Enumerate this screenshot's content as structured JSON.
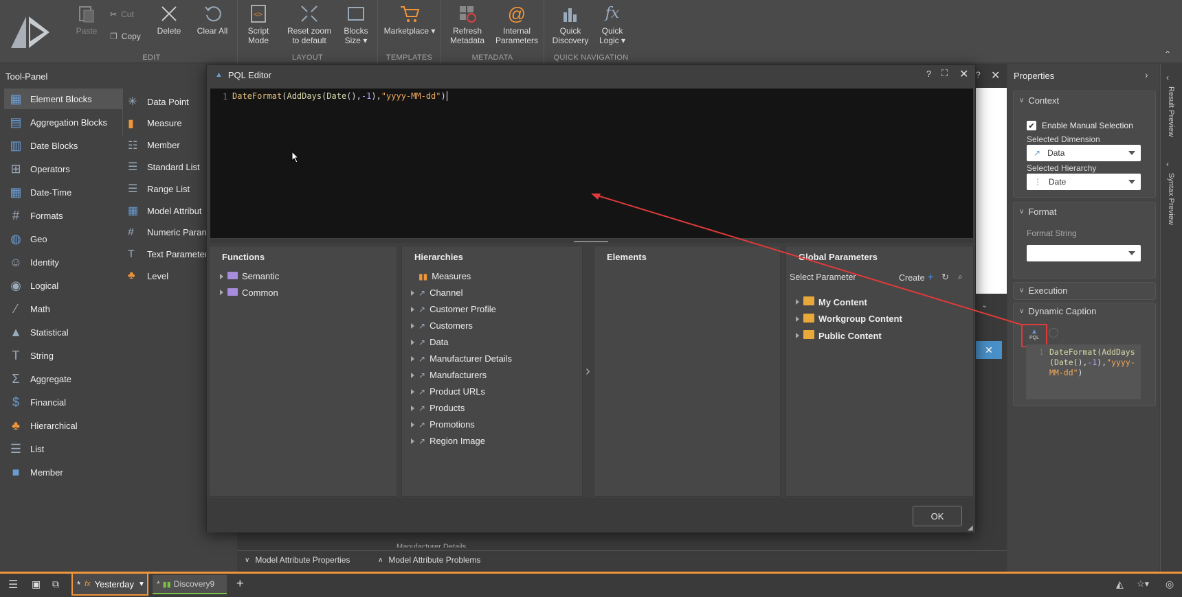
{
  "ribbon": {
    "edit": {
      "label": "EDIT",
      "paste": "Paste",
      "cut": "Cut",
      "copy": "Copy",
      "delete": "Delete",
      "clear_all": "Clear All"
    },
    "layout": {
      "label": "LAYOUT",
      "script_mode": "Script\nMode",
      "reset_zoom": "Reset zoom\nto default",
      "blocks_size": "Blocks\nSize ▾"
    },
    "templates": {
      "label": "TEMPLATES",
      "marketplace": "Marketplace ▾"
    },
    "metadata": {
      "label": "METADATA",
      "refresh": "Refresh\nMetadata",
      "internal": "Internal\nParameters"
    },
    "quick_nav": {
      "label": "QUICK NAVIGATION",
      "quick_discovery": "Quick\nDiscovery",
      "quick_logic": "Quick\nLogic ▾"
    }
  },
  "tool_panel": {
    "title": "Tool-Panel",
    "categories": [
      "Element Blocks",
      "Aggregation Blocks",
      "Date Blocks",
      "Operators",
      "Date-Time",
      "Formats",
      "Geo",
      "Identity",
      "Logical",
      "Math",
      "Statistical",
      "String",
      "Aggregate",
      "Financial",
      "Hierarchical",
      "List",
      "Member"
    ],
    "elements": [
      "Data Point",
      "Measure",
      "Member",
      "Standard List",
      "Range List",
      "Model Attribut",
      "Numeric Paran",
      "Text Parameter",
      "Level"
    ]
  },
  "modal": {
    "title": "PQL Editor",
    "line_number": "1",
    "code": {
      "p1": "DateFormat",
      "p2": "(",
      "p3": "AddDays",
      "p4": "(",
      "p5": "Date",
      "p6": "(),",
      "p7": "-1",
      "p8": "),",
      "p9": "\"yyyy-MM-dd\"",
      "p10": ")"
    },
    "functions": {
      "title": "Functions",
      "items": [
        "Semantic",
        "Common"
      ]
    },
    "hierarchies": {
      "title": "Hierarchies",
      "items": [
        "Measures",
        "Channel",
        "Customer Profile",
        "Customers",
        "Data",
        "Manufacturer Details",
        "Manufacturers",
        "Product URLs",
        "Products",
        "Promotions",
        "Region Image"
      ]
    },
    "elements": {
      "title": "Elements"
    },
    "global_params": {
      "title": "Global Parameters",
      "select": "Select Parameter",
      "create": "Create",
      "items": [
        "My Content",
        "Workgroup Content",
        "Public Content"
      ]
    },
    "ok": "OK"
  },
  "properties": {
    "title": "Properties",
    "context": {
      "title": "Context",
      "enable_manual": "Enable Manual Selection",
      "selected_dimension_label": "Selected Dimension",
      "selected_dimension": "Data",
      "selected_hierarchy_label": "Selected Hierarchy",
      "selected_hierarchy": "Date"
    },
    "format": {
      "title": "Format",
      "format_string_label": "Format String",
      "format_string": ""
    },
    "execution": {
      "title": "Execution"
    },
    "dynamic_caption": {
      "title": "Dynamic Caption",
      "pql_label": "PQL",
      "line": "1",
      "code_l1a": "DateFormat",
      "code_l1b": "(",
      "code_l1c": "AddDays",
      "code_l2a": "(",
      "code_l2b": "Date",
      "code_l2c": "(),",
      "code_l2d": "-1",
      "code_l2e": "),",
      "code_l2f": "\"yyyy-",
      "code_l3a": "MM-dd\"",
      "code_l3b": ")"
    }
  },
  "side_tabs": {
    "result_preview": "Result Preview",
    "syntax_preview": "Syntax Preview"
  },
  "bottom_panel": {
    "model_attr_props": "Model Attribute Properties",
    "model_attr_problems": "Model Attribute Problems",
    "bg_text": "Manufacturer Details"
  },
  "taskbar": {
    "tab_active": "Yesterday",
    "tab_active_prefix": "*",
    "tab2": "Discovery9",
    "tab2_prefix": "*",
    "add": "+"
  },
  "colors": {
    "accent": "#f0953a",
    "red_arrow": "#e03a3a",
    "editor_bg": "#141414",
    "string": "#f0a95a",
    "function": "#e5c07b"
  }
}
